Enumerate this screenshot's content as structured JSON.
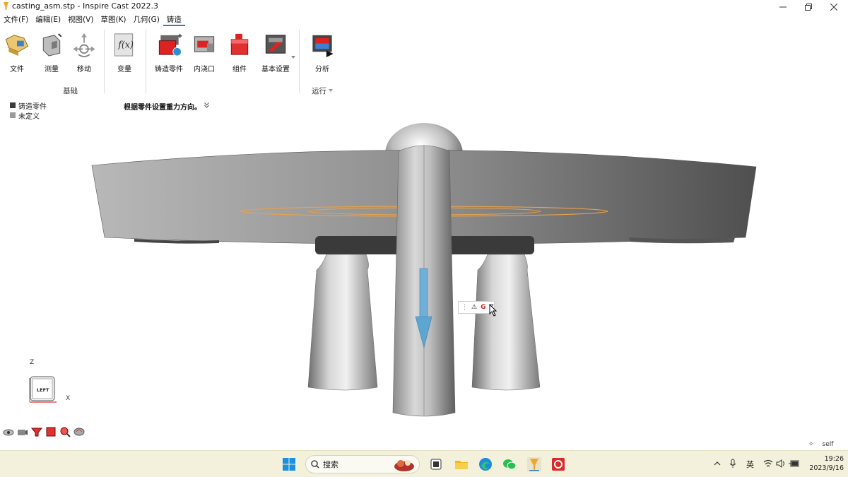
{
  "window": {
    "title": "casting_asm.stp - Inspire Cast 2022.3"
  },
  "menu": {
    "items": [
      {
        "label": "文件(F)"
      },
      {
        "label": "编辑(E)"
      },
      {
        "label": "视图(V)"
      },
      {
        "label": "草图(K)"
      },
      {
        "label": "几何(G)"
      },
      {
        "label": "铸造"
      }
    ],
    "active_index": 5
  },
  "ribbon": {
    "buttons": [
      {
        "label": "文件",
        "icon": "file-folder-icon"
      },
      {
        "label": "测量",
        "icon": "measure-icon"
      },
      {
        "label": "移动",
        "icon": "move-icon"
      },
      {
        "label": "变量",
        "icon": "variable-fx-icon"
      },
      {
        "label": "铸造零件",
        "icon": "casting-part-icon"
      },
      {
        "label": "内浇口",
        "icon": "ingate-icon"
      },
      {
        "label": "组件",
        "icon": "component-icon"
      },
      {
        "label": "基本设置",
        "icon": "basic-settings-icon"
      },
      {
        "label": "分析",
        "icon": "analysis-icon"
      }
    ],
    "groups": {
      "basic": "基础",
      "run": "运行"
    }
  },
  "legend": {
    "items": [
      {
        "label": "铸造零件",
        "color": "#3a3a3a"
      },
      {
        "label": "未定义",
        "color": "#9a9a9a"
      }
    ]
  },
  "hint": {
    "text": "根据零件设置重力方向。"
  },
  "gravity_tooltip": {
    "label": "G"
  },
  "view_cube": {
    "face": "LEFT",
    "axis_z": "Z",
    "axis_x": "X"
  },
  "status": {
    "self_label": "self"
  },
  "taskbar": {
    "search_label": "搜索",
    "ime": "英",
    "time": "19:26",
    "date": "2023/9/16"
  },
  "colors": {
    "accent": "#2f7fc1",
    "taskbar_bg": "#f3f0dc",
    "gravity_arrow": "#5ea6d2",
    "sketch_ring": "#e8a24a"
  }
}
